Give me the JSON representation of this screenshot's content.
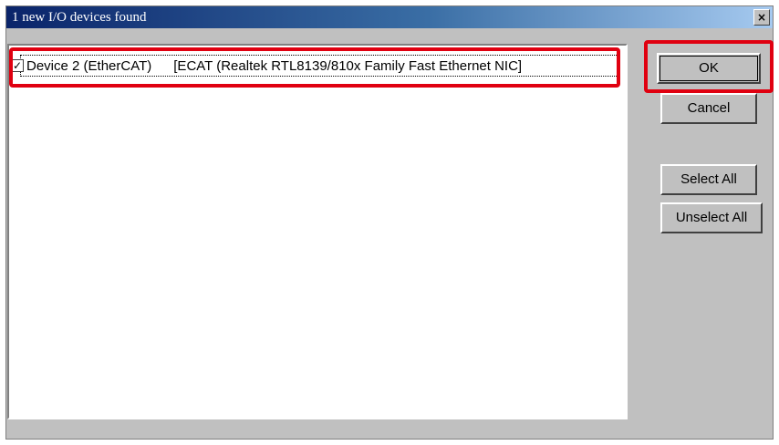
{
  "dialog": {
    "title": "1 new I/O devices found",
    "close_label": "×"
  },
  "devices": [
    {
      "checked": true,
      "name": "Device 2 (EtherCAT)",
      "adapter": "[ECAT (Realtek RTL8139/810x Family Fast Ethernet NIC]"
    }
  ],
  "buttons": {
    "ok": "OK",
    "cancel": "Cancel",
    "select_all": "Select All",
    "unselect_all": "Unselect All"
  },
  "highlight_color": "#e00010"
}
